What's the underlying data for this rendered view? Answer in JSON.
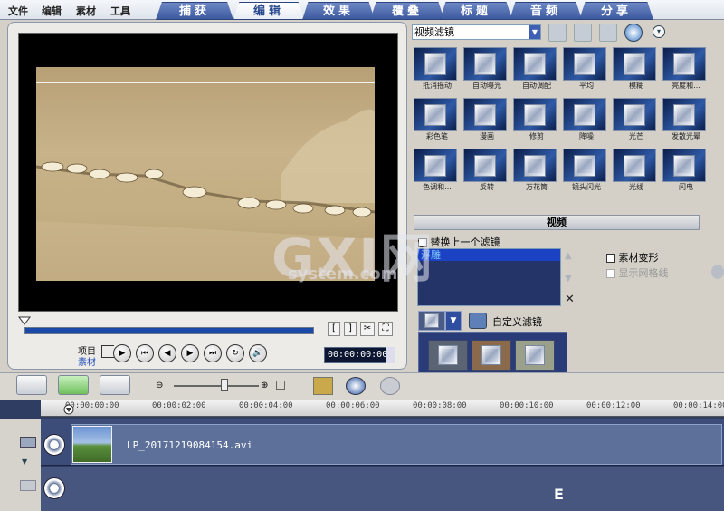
{
  "menu": [
    "文件",
    "编辑",
    "素材",
    "工具"
  ],
  "tabs": [
    "捕获",
    "编辑",
    "效果",
    "覆叠",
    "标题",
    "音频",
    "分享"
  ],
  "active_tab": "编辑",
  "preview": {
    "project_label": "项目",
    "clip_label": "素材",
    "timecode": "00:00:00:00"
  },
  "filter_panel": {
    "category": "视频滤镜",
    "thumbnails": [
      {
        "label": "抵消摇动"
      },
      {
        "label": "自动曝光"
      },
      {
        "label": "自动调配"
      },
      {
        "label": "平均"
      },
      {
        "label": "模糊"
      },
      {
        "label": "亮度和..."
      },
      {
        "label": "彩色笔"
      },
      {
        "label": "漫画"
      },
      {
        "label": "修剪"
      },
      {
        "label": "降噪"
      },
      {
        "label": "光芒"
      },
      {
        "label": "发散光晕"
      },
      {
        "label": "色调和..."
      },
      {
        "label": "反转"
      },
      {
        "label": "万花筒"
      },
      {
        "label": "镜头闪光"
      },
      {
        "label": "光线"
      },
      {
        "label": "闪电"
      }
    ]
  },
  "video_section": {
    "header": "视频",
    "replace_filter_label": "替换上一个滤镜",
    "applied_filters": [
      "浮雕"
    ],
    "transform_label": "素材变形",
    "show_grid_label": "显示网格线",
    "custom_filter_label": "自定义滤镜"
  },
  "timeline": {
    "ticks": [
      "00:00:00:00",
      "00:00:02:00",
      "00:00:04:00",
      "00:00:06:00",
      "00:00:08:00",
      "00:00:10:00",
      "00:00:12:00",
      "00:00:14:00"
    ],
    "clip_name": "LP_20171219084154.avi"
  },
  "watermark": {
    "main": "GXI网",
    "sub": "system.com"
  },
  "colors": {
    "tab_blue": "#3d5aa0",
    "selection_blue": "#1c42c4",
    "timeline_bg": "#303d62"
  }
}
